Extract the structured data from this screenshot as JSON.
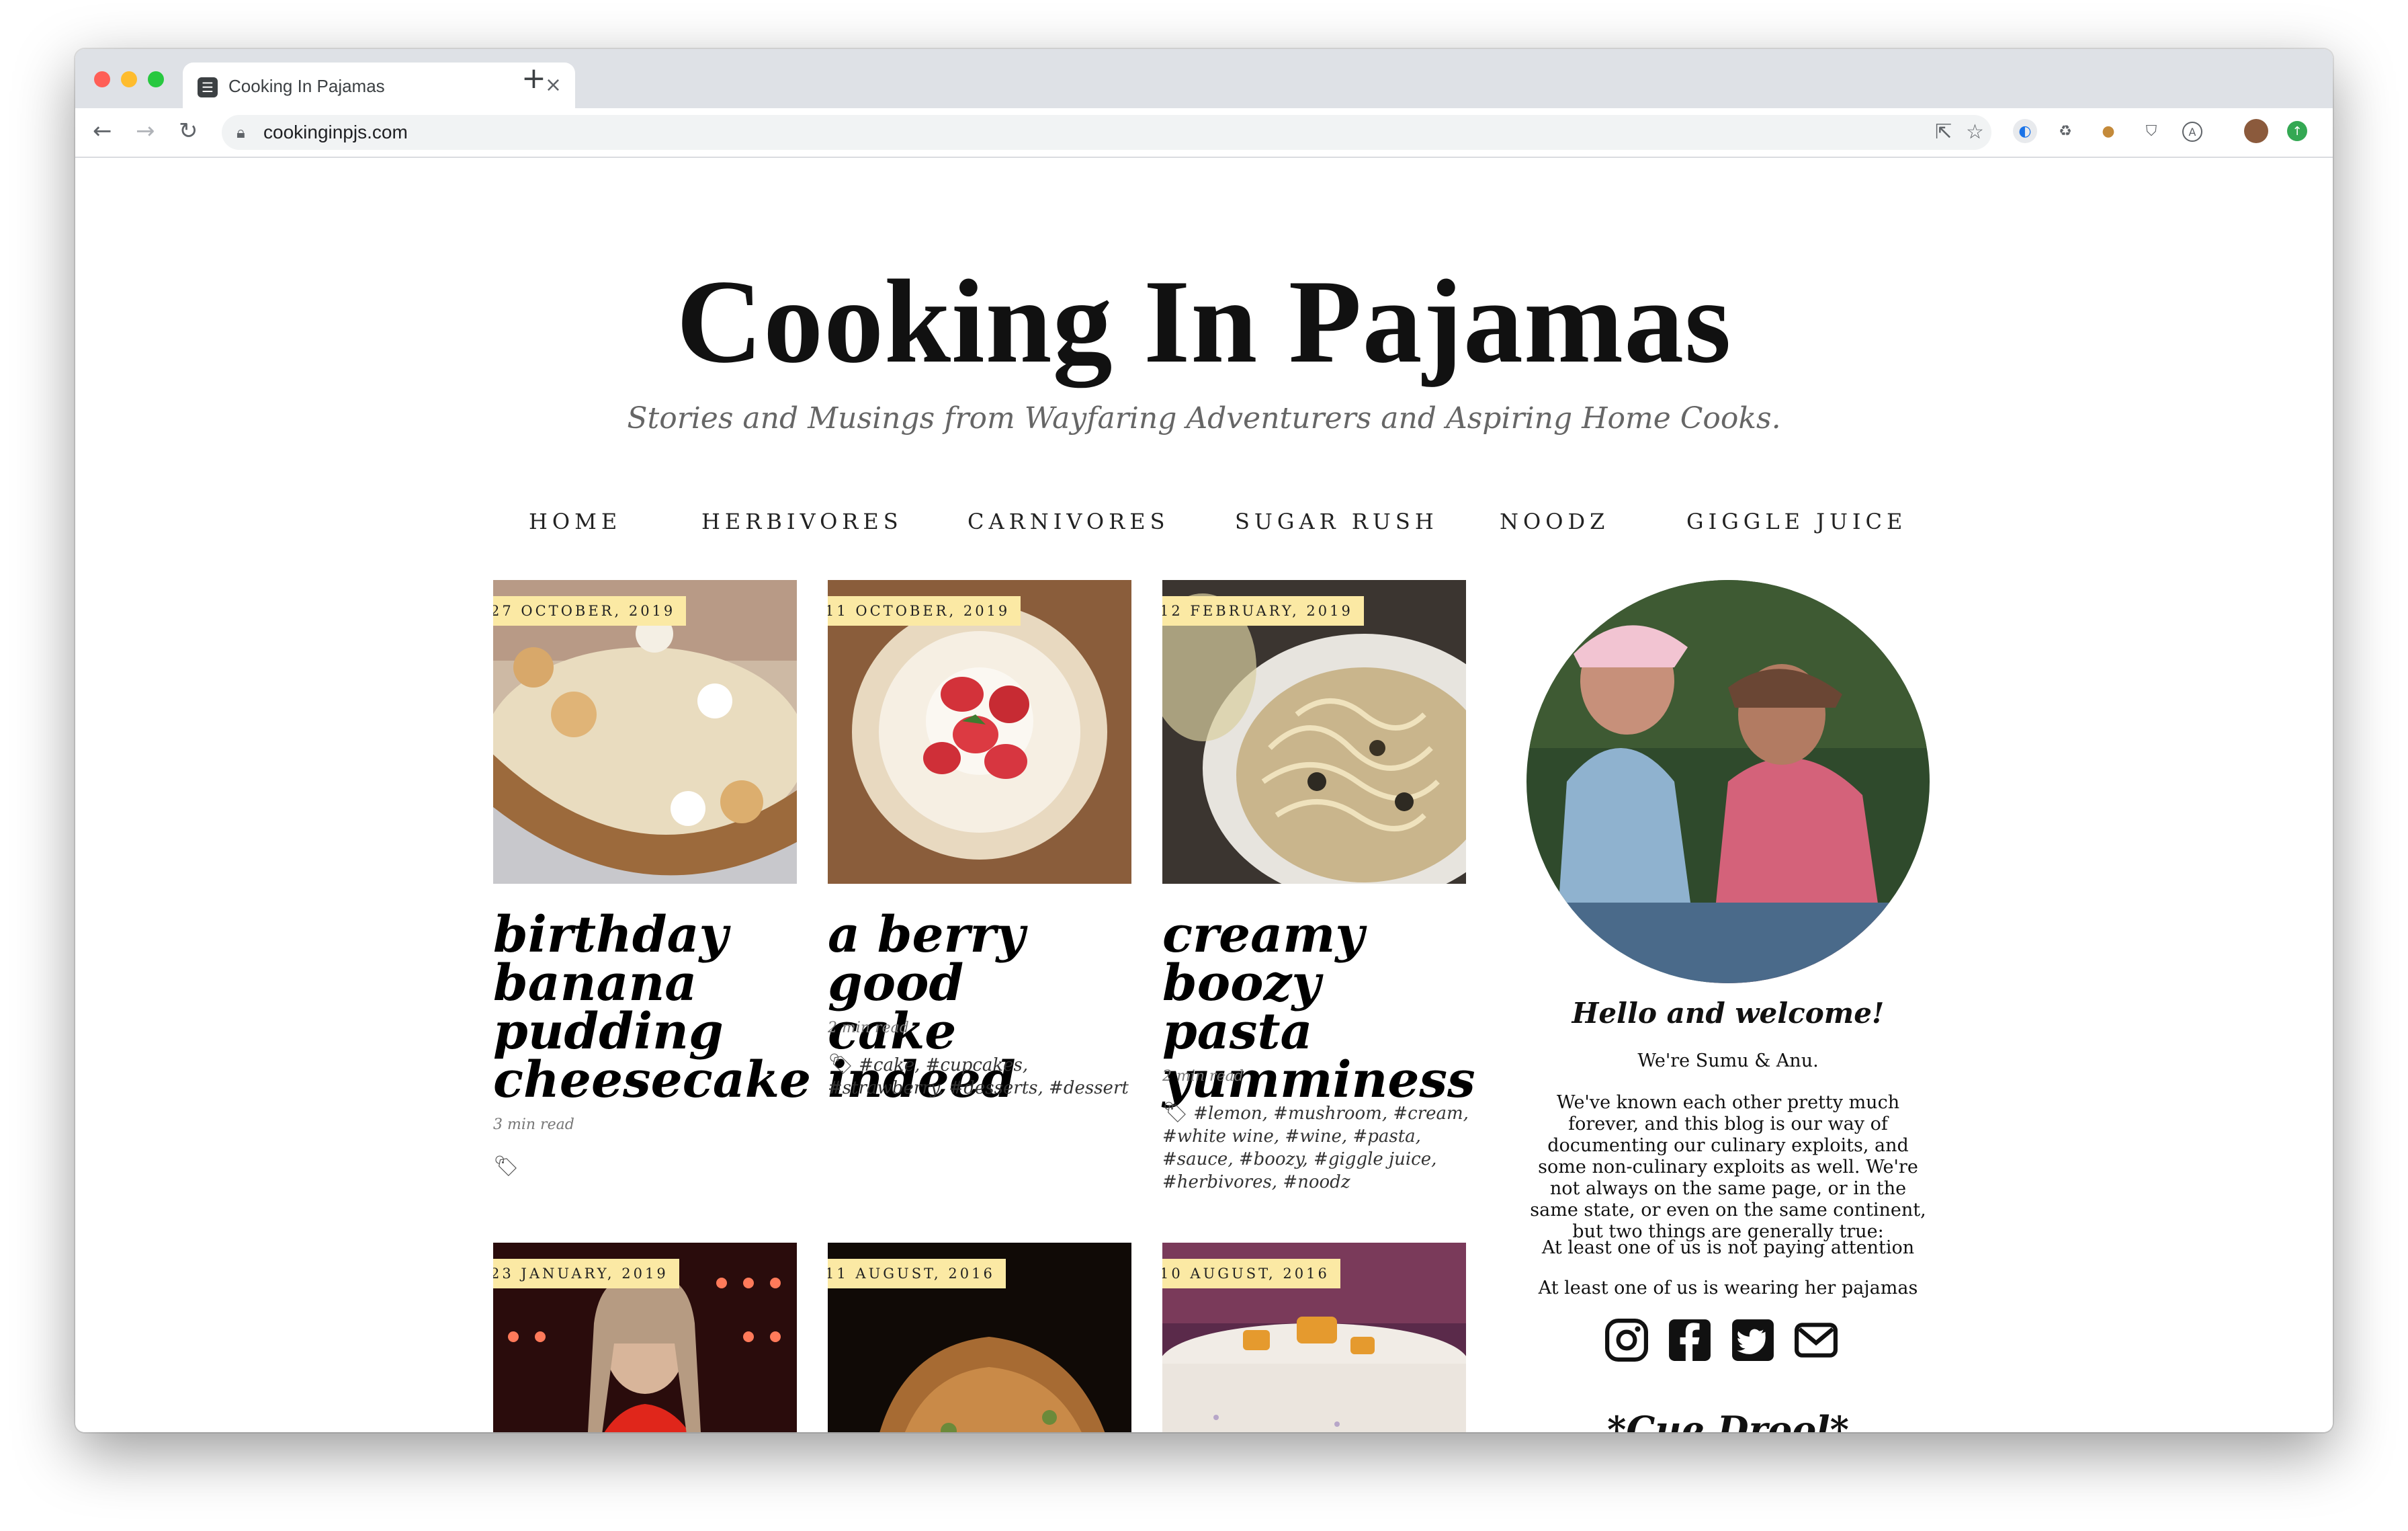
{
  "browser": {
    "tab_title": "Cooking In Pajamas",
    "tab_close": "×",
    "new_tab": "+",
    "url": "cookinginpjs.com"
  },
  "site": {
    "title": "Cooking In Pajamas",
    "tagline": "Stories and Musings from Wayfaring Adventurers and Aspiring Home Cooks."
  },
  "nav": [
    "HOME",
    "HERBIVORES",
    "CARNIVORES",
    "SUGAR RUSH",
    "NOODZ",
    "GIGGLE JUICE"
  ],
  "posts": [
    {
      "date": "27 OCTOBER, 2019",
      "title_lines": [
        "birthday",
        "banana",
        "pudding",
        "cheesecake"
      ],
      "read_time": "3 min read",
      "tags": ""
    },
    {
      "date": "11 OCTOBER, 2019",
      "title_lines": [
        "a berry good",
        "cake indeed"
      ],
      "read_time": "2 min read",
      "tags": "#cake, #cupcakes, #strawberry, #desserts, #dessert"
    },
    {
      "date": "12 FEBRUARY, 2019",
      "title_lines": [
        "creamy",
        "boozy pasta",
        "yumminess"
      ],
      "read_time": "2 min read",
      "tags": "#lemon, #mushroom, #cream, #white wine, #wine, #pasta, #sauce, #boozy, #giggle juice, #herbivores, #noodz"
    },
    {
      "date": "23 JANUARY, 2019"
    },
    {
      "date": "11 AUGUST, 2016"
    },
    {
      "date": "10 AUGUST, 2016"
    }
  ],
  "sidebar": {
    "hello": "Hello and welcome!",
    "intro": "We're Sumu & Anu.",
    "about": "We've known each other pretty much forever, and this blog is our way of documenting our culinary exploits, and some non-culinary exploits as well. We're not always on the same page, or in the same state, or even on the same continent, but two things are generally true:",
    "truth1": "At least one of us is not paying attention",
    "truth2": "At least one of us is wearing her pajamas",
    "social": [
      "instagram-icon",
      "facebook-icon",
      "twitter-icon",
      "mail-icon"
    ],
    "cue": "*Cue Drool*"
  }
}
